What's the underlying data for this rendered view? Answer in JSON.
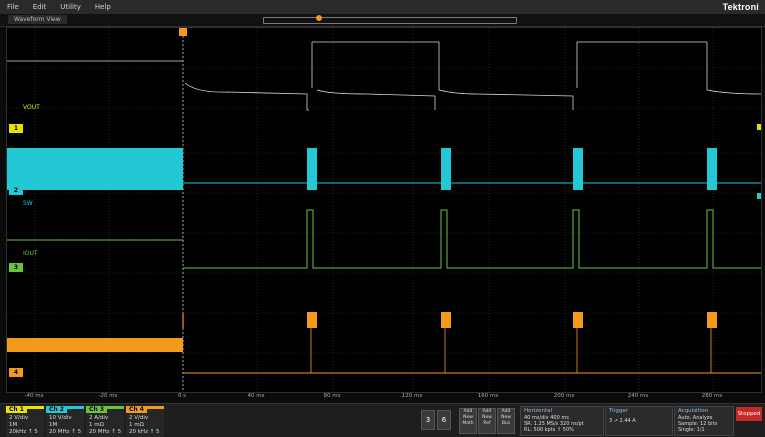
{
  "menu": {
    "items": [
      "File",
      "Edit",
      "Utility",
      "Help"
    ],
    "brand": "Tektroni"
  },
  "waveform_view": {
    "title": "Waveform View"
  },
  "channels": [
    {
      "id": "1",
      "label": "VOUT",
      "color": "#e8e200",
      "marker": "1"
    },
    {
      "id": "2",
      "label": "SW",
      "color": "#22c8d4",
      "marker": "2"
    },
    {
      "id": "3",
      "label": "IOUT",
      "color": "#6ac43a",
      "marker": "3"
    },
    {
      "id": "4",
      "label": "",
      "color": "#f39a1d",
      "marker": "4"
    }
  ],
  "time_ticks": [
    "-40 ms",
    "-20 ms",
    "0 s",
    "40 ms",
    "80 ms",
    "120 ms",
    "160 ms",
    "200 ms",
    "240 ms",
    "280 ms"
  ],
  "badges": [
    {
      "name": "Ch 1",
      "color": "#e8e200",
      "lines": [
        "2 V/div",
        "1M",
        "20kHz  ↑ 5"
      ]
    },
    {
      "name": "Ch 2",
      "color": "#22c8d4",
      "lines": [
        "10 V/div",
        "1M",
        "20 MHz ↑ 5"
      ]
    },
    {
      "name": "Ch 3",
      "color": "#6ac43a",
      "lines": [
        "2 A/div",
        "1 mΩ",
        "20 MHz ↑ 5"
      ]
    },
    {
      "name": "Ch 4",
      "color": "#f39a1d",
      "lines": [
        "2 V/div",
        "1 mΩ",
        "20 kHz ↑ 5"
      ]
    }
  ],
  "buttons": {
    "b3": "3",
    "b6": "6"
  },
  "add_buttons": [
    [
      "Add",
      "New",
      "Math"
    ],
    [
      "Add",
      "New",
      "Ref"
    ],
    [
      "Add",
      "New",
      "Bus"
    ]
  ],
  "horizontal": {
    "title": "Horizontal",
    "lines": [
      "40 ms/div   400 ms",
      "SR: 1.25 MS/s   320 ns/pt",
      "RL: 500 kpts   ↑ 50%"
    ]
  },
  "trigger": {
    "title": "Trigger",
    "lines": [
      "3  ↗  2.44 A"
    ]
  },
  "acquisition": {
    "title": "Acquisition",
    "lines": [
      "Auto,   Analyze",
      "Sample: 12 bits",
      "Single: 1/1"
    ]
  },
  "stop": "Stopped"
}
